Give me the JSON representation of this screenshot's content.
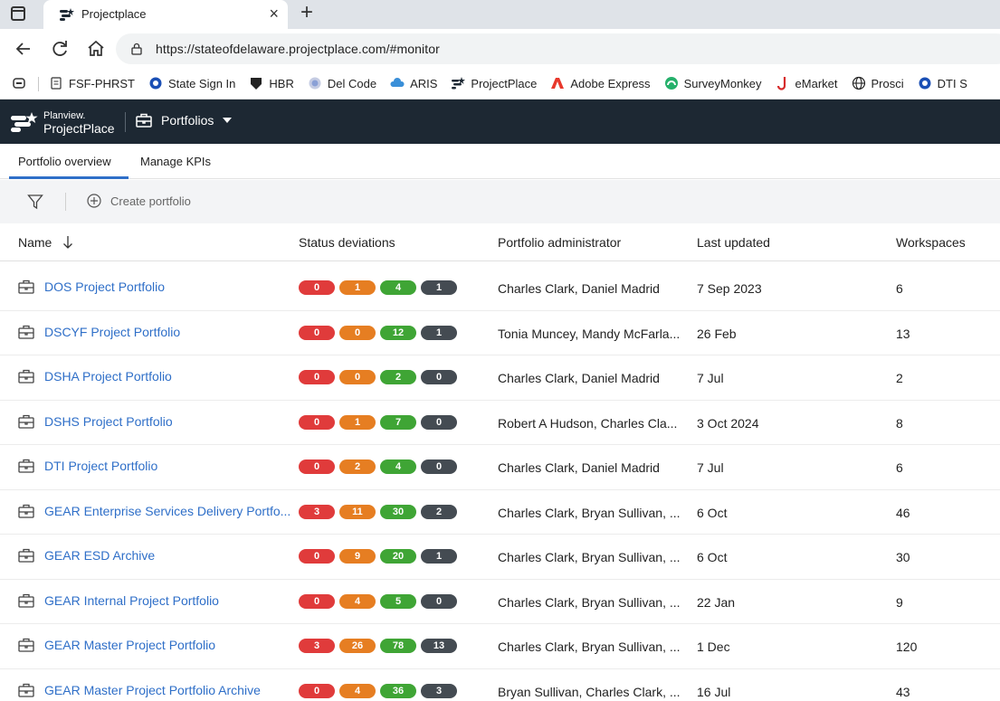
{
  "browser": {
    "tab_title": "Projectplace",
    "tab_close": "×",
    "new_tab": "+",
    "url": "https://stateofdelaware.projectplace.com/#monitor",
    "bookmarks": [
      {
        "label": "FSF-PHRST",
        "icon": "page-icon"
      },
      {
        "label": "State Sign In",
        "icon": "circle-icon"
      },
      {
        "label": "HBR",
        "icon": "shield-icon"
      },
      {
        "label": "Del Code",
        "icon": "seal-icon"
      },
      {
        "label": "ARIS",
        "icon": "cloud-icon"
      },
      {
        "label": "ProjectPlace",
        "icon": "projectplace-icon"
      },
      {
        "label": "Adobe Express",
        "icon": "adobe-icon"
      },
      {
        "label": "SurveyMonkey",
        "icon": "surveymonkey-icon"
      },
      {
        "label": "eMarket",
        "icon": "emarket-icon"
      },
      {
        "label": "Prosci",
        "icon": "globe-icon"
      },
      {
        "label": "DTI S",
        "icon": "circle-icon"
      }
    ]
  },
  "app": {
    "logo_line1": "Planview.",
    "logo_line2": "ProjectPlace",
    "section": "Portfolios"
  },
  "subtabs": [
    "Portfolio overview",
    "Manage KPIs"
  ],
  "toolbar": {
    "create_label": "Create portfolio"
  },
  "table": {
    "columns": [
      "Name",
      "Status deviations",
      "Portfolio administrator",
      "Last updated",
      "Workspaces"
    ],
    "rows": [
      {
        "name": "DOS Project Portfolio",
        "status": [
          "0",
          "1",
          "4",
          "1"
        ],
        "admin": "Charles Clark, Daniel Madrid",
        "updated": "7 Sep 2023",
        "workspaces": "6"
      },
      {
        "name": "DSCYF Project Portfolio",
        "status": [
          "0",
          "0",
          "12",
          "1"
        ],
        "admin": "Tonia Muncey, Mandy McFarla...",
        "updated": "26 Feb",
        "workspaces": "13"
      },
      {
        "name": "DSHA Project Portfolio",
        "status": [
          "0",
          "0",
          "2",
          "0"
        ],
        "admin": "Charles Clark, Daniel Madrid",
        "updated": "7 Jul",
        "workspaces": "2"
      },
      {
        "name": "DSHS Project Portfolio",
        "status": [
          "0",
          "1",
          "7",
          "0"
        ],
        "admin": "Robert A Hudson, Charles Cla...",
        "updated": "3 Oct 2024",
        "workspaces": "8"
      },
      {
        "name": "DTI Project Portfolio",
        "status": [
          "0",
          "2",
          "4",
          "0"
        ],
        "admin": "Charles Clark, Daniel Madrid",
        "updated": "7 Jul",
        "workspaces": "6"
      },
      {
        "name": "GEAR Enterprise Services Delivery Portfo...",
        "status": [
          "3",
          "11",
          "30",
          "2"
        ],
        "admin": "Charles Clark, Bryan Sullivan, ...",
        "updated": "6 Oct",
        "workspaces": "46"
      },
      {
        "name": "GEAR ESD Archive",
        "status": [
          "0",
          "9",
          "20",
          "1"
        ],
        "admin": "Charles Clark, Bryan Sullivan, ...",
        "updated": "6 Oct",
        "workspaces": "30"
      },
      {
        "name": "GEAR Internal Project Portfolio",
        "status": [
          "0",
          "4",
          "5",
          "0"
        ],
        "admin": "Charles Clark, Bryan Sullivan, ...",
        "updated": "22 Jan",
        "workspaces": "9"
      },
      {
        "name": "GEAR Master Project Portfolio",
        "status": [
          "3",
          "26",
          "78",
          "13"
        ],
        "admin": "Charles Clark, Bryan Sullivan, ...",
        "updated": "1 Dec",
        "workspaces": "120"
      },
      {
        "name": "GEAR Master Project Portfolio Archive",
        "status": [
          "0",
          "4",
          "36",
          "3"
        ],
        "admin": "Bryan Sullivan, Charles Clark, ...",
        "updated": "16 Jul",
        "workspaces": "43"
      }
    ]
  },
  "colors": {
    "status_red": "#e03b3b",
    "status_orange": "#e67e22",
    "status_green": "#3fa535",
    "status_gray": "#444b52",
    "link": "#2f6fc8",
    "appbar": "#1d2833"
  }
}
